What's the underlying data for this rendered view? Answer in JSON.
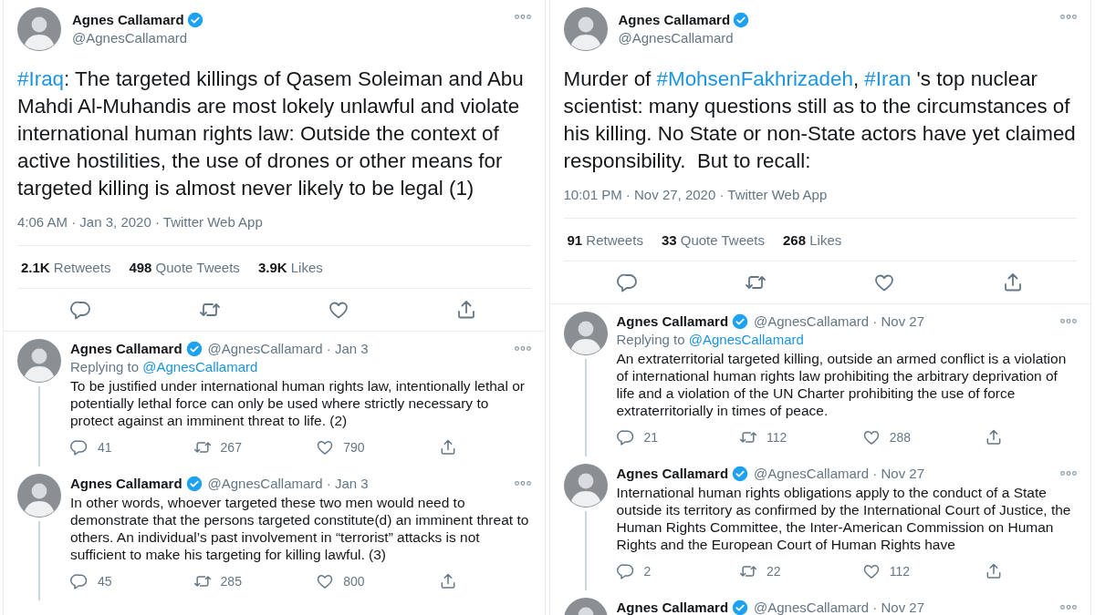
{
  "separator": "·",
  "columns": [
    {
      "tweet": {
        "name": "Agnes Callamard",
        "verified": true,
        "handle": "@AgnesCallamard",
        "text": [
          {
            "kind": "hashtag",
            "text": "#Iraq"
          },
          {
            "kind": "plain",
            "text": ": The targeted killings of Qasem Soleiman and Abu Mahdi Al-Muhandis are most lokely unlawful and violate international human rights law: Outside the context of active hostilities, the use of drones or other means for targeted killing is almost never likely to be legal (1)"
          }
        ],
        "meta": "4:06 AM · Jan 3, 2020 · Twitter Web App",
        "stats": [
          {
            "count": "2.1K",
            "label": "Retweets"
          },
          {
            "count": "498",
            "label": "Quote Tweets"
          },
          {
            "count": "3.9K",
            "label": "Likes"
          }
        ]
      },
      "replies": [
        {
          "name": "Agnes Callamard",
          "verified": true,
          "handle": "@AgnesCallamard",
          "date": "Jan 3",
          "replying_label": "Replying to",
          "replying_handle": "@AgnesCallamard",
          "text": "To be justified under international human rights law, intentionally lethal or potentially lethal force can only be used where strictly necessary to protect against an imminent threat to life. (2)",
          "replies": "41",
          "retweets": "267",
          "likes": "790"
        },
        {
          "name": "Agnes Callamard",
          "verified": true,
          "handle": "@AgnesCallamard",
          "date": "Jan 3",
          "text": "In other words, whoever targeted these two men would need to demonstrate that the persons targeted constitute(d) an imminent threat to others. An individual’s past involvement in “terrorist” attacks is not sufficient to make his targeting for killing lawful. (3)",
          "replies": "45",
          "retweets": "285",
          "likes": "800"
        }
      ]
    },
    {
      "tweet": {
        "name": "Agnes Callamard",
        "verified": true,
        "handle": "@AgnesCallamard",
        "text": [
          {
            "kind": "plain",
            "text": "Murder of "
          },
          {
            "kind": "hashtag",
            "text": "#MohsenFakhrizadeh"
          },
          {
            "kind": "plain",
            "text": ", "
          },
          {
            "kind": "hashtag",
            "text": "#Iran"
          },
          {
            "kind": "plain",
            "text": " 's top nuclear scientist: many questions still as to the circumstances of his killing. No State or non-State actors have yet claimed responsibility.  But to recall:"
          }
        ],
        "meta": "10:01 PM · Nov 27, 2020 · Twitter Web App",
        "stats": [
          {
            "count": "91",
            "label": "Retweets"
          },
          {
            "count": "33",
            "label": "Quote Tweets"
          },
          {
            "count": "268",
            "label": "Likes"
          }
        ]
      },
      "replies": [
        {
          "name": "Agnes Callamard",
          "verified": true,
          "handle": "@AgnesCallamard",
          "date": "Nov 27",
          "replying_label": "Replying to",
          "replying_handle": "@AgnesCallamard",
          "text": "An extraterritorial targeted killing, outside an armed conflict is a violation of international human rights law prohibiting the arbitrary deprivation of life and a violation of the UN Charter prohibiting the use of force extraterritorially in times of peace.",
          "replies": "21",
          "retweets": "112",
          "likes": "288"
        },
        {
          "name": "Agnes Callamard",
          "verified": true,
          "handle": "@AgnesCallamard",
          "date": "Nov 27",
          "text": "International human rights obligations apply to the conduct of a State outside its territory as confirmed by the International Court of Justice, the Human Rights Committee, the Inter-American Commission on Human Rights and the European Court of Human Rights  have",
          "replies": "2",
          "retweets": "22",
          "likes": "112"
        },
        {
          "name": "Agnes Callamard",
          "verified": true,
          "handle": "@AgnesCallamard",
          "date": "Nov 27"
        }
      ]
    }
  ]
}
